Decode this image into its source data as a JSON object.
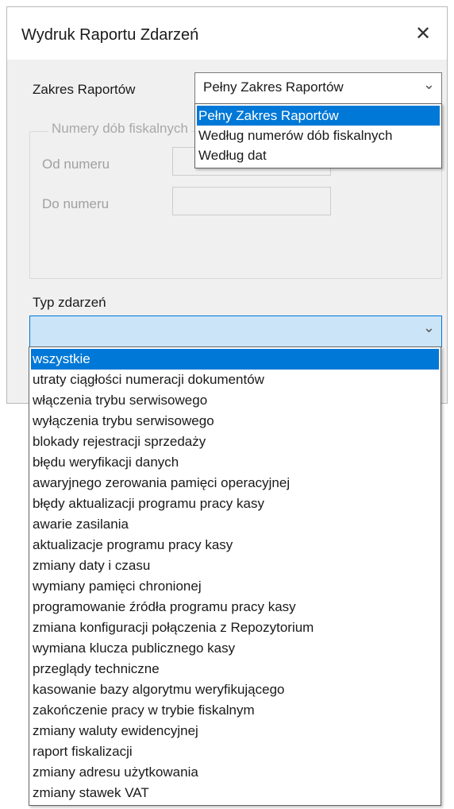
{
  "window": {
    "title": "Wydruk Raportu Zdarzeń",
    "close_glyph": "✕"
  },
  "report_range": {
    "label": "Zakres Raportów",
    "selected": "Pełny Zakres Raportów",
    "arrow_icon": "chevron-down-icon",
    "options": [
      "Pełny Zakres Raportów",
      "Według numerów dób fiskalnych",
      "Według dat"
    ],
    "highlighted_index": 0
  },
  "fiscal_days_group": {
    "title": "Numery dób fiskalnych",
    "from_label": "Od numeru",
    "to_label": "Do numeru",
    "from_value": "",
    "to_value": ""
  },
  "event_type": {
    "label": "Typ zdarzeń",
    "selected": "",
    "highlighted_index": 0,
    "options": [
      "wszystkie",
      "utraty ciągłości numeracji dokumentów",
      "włączenia trybu serwisowego",
      "wyłączenia trybu serwisowego",
      "blokady rejestracji sprzedaży",
      "błędu weryfikacji danych",
      "awaryjnego zerowania pamięci operacyjnej",
      "błędy aktualizacji programu pracy kasy",
      "awarie zasilania",
      "aktualizacje programu pracy kasy",
      "zmiany daty i czasu",
      "wymiany pamięci chronionej",
      "programowanie źródła programu pracy kasy",
      "zmiana konfiguracji połączenia z Repozytorium",
      "wymiana klucza publicznego kasy",
      "przeglądy techniczne",
      "kasowanie bazy algorytmu weryfikującego",
      "zakończenie pracy w trybie fiskalnym",
      "zmiany waluty ewidencyjnej",
      "raport fiskalizacji",
      "zmiany adresu użytkowania",
      "zmiany stawek VAT"
    ]
  },
  "colors": {
    "selection": "#0078d7",
    "dialog_bg": "#f0f0f0",
    "disabled_text": "#a0a0a0"
  }
}
